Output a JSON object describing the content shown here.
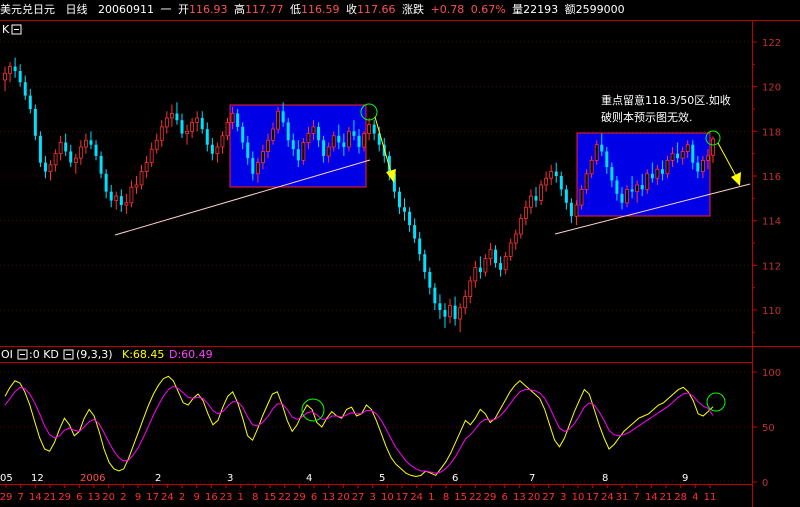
{
  "header": {
    "symbol": "美元兑日元",
    "period": "日线",
    "date": "20060911",
    "weekday": "一",
    "open_label": "开",
    "open": "116.93",
    "high_label": "高",
    "high": "117.77",
    "low_label": "低",
    "low": "116.59",
    "close_label": "收",
    "close": "117.66",
    "change_label": "涨跌",
    "change": "+0.78",
    "change_pct": "0.67%",
    "volume_label": "量",
    "volume": "22193",
    "amount_label": "额",
    "amount": "2599000"
  },
  "main_panel": {
    "label": "K",
    "annotation_line1": "重点留意118.3/50区.如收",
    "annotation_line2": "破则本预示图无效.",
    "colors": {
      "up": "#ff3232",
      "down": "#00e0ff",
      "box_fill": "#0000e6",
      "box_edge": "#ff2020",
      "trend": "#ffd0d0",
      "arrow": "#ffff00",
      "circle": "#00ff00",
      "axis": "#c00000"
    }
  },
  "indicator_panel": {
    "label": "OI",
    "sub_label": ":0 KD",
    "params": "(9,3,3)",
    "k_label": "K:68.45",
    "d_label": "D:60.49",
    "k_color": "#ffff00",
    "d_color": "#ff00ff"
  },
  "chart_data": [
    {
      "type": "candlestick",
      "y_axis_ticks": [
        "122",
        "120",
        "118",
        "116",
        "114",
        "112",
        "110"
      ],
      "ylim": [
        108.5,
        122.5
      ],
      "ohlc_approx": [
        [
          120.3,
          120.9,
          119.8,
          120.6
        ],
        [
          120.6,
          121.1,
          120.2,
          120.9
        ],
        [
          120.9,
          121.3,
          120.4,
          120.7
        ],
        [
          120.7,
          121.0,
          120.0,
          120.2
        ],
        [
          120.2,
          120.5,
          119.4,
          119.6
        ],
        [
          119.6,
          119.9,
          118.8,
          119.0
        ],
        [
          119.0,
          119.2,
          117.6,
          117.8
        ],
        [
          117.8,
          118.0,
          116.4,
          116.6
        ],
        [
          116.6,
          116.9,
          115.9,
          116.2
        ],
        [
          116.2,
          116.7,
          115.8,
          116.5
        ],
        [
          116.5,
          117.2,
          116.2,
          117.0
        ],
        [
          117.0,
          117.8,
          116.7,
          117.5
        ],
        [
          117.5,
          117.9,
          116.9,
          117.1
        ],
        [
          117.1,
          117.4,
          116.4,
          116.6
        ],
        [
          116.6,
          117.0,
          116.1,
          116.8
        ],
        [
          116.8,
          117.6,
          116.5,
          117.3
        ],
        [
          117.3,
          117.9,
          117.0,
          117.6
        ],
        [
          117.6,
          118.0,
          117.2,
          117.4
        ],
        [
          117.4,
          117.6,
          116.7,
          116.9
        ],
        [
          116.9,
          117.1,
          115.9,
          116.1
        ],
        [
          116.1,
          116.3,
          115.0,
          115.3
        ],
        [
          115.3,
          115.6,
          114.6,
          114.9
        ],
        [
          114.9,
          115.3,
          114.5,
          115.1
        ],
        [
          115.1,
          115.4,
          114.4,
          114.7
        ],
        [
          114.7,
          115.2,
          114.3,
          114.8
        ],
        [
          114.8,
          115.8,
          114.6,
          115.5
        ],
        [
          115.5,
          116.0,
          115.2,
          115.6
        ],
        [
          115.6,
          116.5,
          115.4,
          116.2
        ],
        [
          116.2,
          116.9,
          115.9,
          116.6
        ],
        [
          116.6,
          117.5,
          116.4,
          117.2
        ],
        [
          117.2,
          117.9,
          117.0,
          117.6
        ],
        [
          117.6,
          118.5,
          117.3,
          118.2
        ],
        [
          118.2,
          118.9,
          117.9,
          118.6
        ],
        [
          118.6,
          119.2,
          118.2,
          118.8
        ],
        [
          118.8,
          119.3,
          118.3,
          118.5
        ],
        [
          118.5,
          118.8,
          117.7,
          117.9
        ],
        [
          117.9,
          118.3,
          117.4,
          118.0
        ],
        [
          118.0,
          118.6,
          117.7,
          118.4
        ],
        [
          118.4,
          118.9,
          118.0,
          118.6
        ],
        [
          118.6,
          118.9,
          117.9,
          118.1
        ],
        [
          118.1,
          118.4,
          117.1,
          117.4
        ],
        [
          117.4,
          117.7,
          116.7,
          117.0
        ],
        [
          117.0,
          117.5,
          116.6,
          117.3
        ],
        [
          117.3,
          118.0,
          117.0,
          117.8
        ],
        [
          117.8,
          118.6,
          117.6,
          118.4
        ],
        [
          118.4,
          119.1,
          118.1,
          118.8
        ],
        [
          118.8,
          119.0,
          118.0,
          118.2
        ],
        [
          118.2,
          118.4,
          117.2,
          117.5
        ],
        [
          117.5,
          117.8,
          116.5,
          116.8
        ],
        [
          116.8,
          117.1,
          115.8,
          116.1
        ],
        [
          116.1,
          116.8,
          115.7,
          116.6
        ],
        [
          116.6,
          117.4,
          116.3,
          117.1
        ],
        [
          117.1,
          117.9,
          116.8,
          117.6
        ],
        [
          117.6,
          118.4,
          117.4,
          118.1
        ],
        [
          118.1,
          119.1,
          117.9,
          118.9
        ],
        [
          118.9,
          119.3,
          118.2,
          118.4
        ],
        [
          118.4,
          118.6,
          117.3,
          117.6
        ],
        [
          117.6,
          117.9,
          116.9,
          117.2
        ],
        [
          117.2,
          117.6,
          116.4,
          116.7
        ],
        [
          116.7,
          117.7,
          116.5,
          117.5
        ],
        [
          117.5,
          118.2,
          117.2,
          117.9
        ],
        [
          117.9,
          118.5,
          117.6,
          118.2
        ],
        [
          118.2,
          118.4,
          117.3,
          117.6
        ],
        [
          117.6,
          117.8,
          116.6,
          116.9
        ],
        [
          116.9,
          117.5,
          116.6,
          117.3
        ],
        [
          117.3,
          118.0,
          117.1,
          117.8
        ],
        [
          117.8,
          118.3,
          117.2,
          117.5
        ],
        [
          117.5,
          117.9,
          116.9,
          117.3
        ],
        [
          117.3,
          118.2,
          117.1,
          118.0
        ],
        [
          118.0,
          118.5,
          117.6,
          117.8
        ],
        [
          117.8,
          118.1,
          117.0,
          117.3
        ],
        [
          117.3,
          118.0,
          117.1,
          117.9
        ],
        [
          117.9,
          118.6,
          117.6,
          118.3
        ],
        [
          118.3,
          118.5,
          117.6,
          117.9
        ],
        [
          117.9,
          118.2,
          117.1,
          117.4
        ],
        [
          117.4,
          117.7,
          116.6,
          116.9
        ],
        [
          116.9,
          117.1,
          115.8,
          116.1
        ],
        [
          116.1,
          116.3,
          115.0,
          115.3
        ],
        [
          115.3,
          115.5,
          114.3,
          114.6
        ],
        [
          114.6,
          115.0,
          114.0,
          114.4
        ],
        [
          114.4,
          114.6,
          113.5,
          113.8
        ],
        [
          113.8,
          114.1,
          113.0,
          113.2
        ],
        [
          113.2,
          113.5,
          112.2,
          112.5
        ],
        [
          112.5,
          112.7,
          111.4,
          111.7
        ],
        [
          111.7,
          111.9,
          110.7,
          111.0
        ],
        [
          111.0,
          111.2,
          110.0,
          110.3
        ],
        [
          110.3,
          110.7,
          109.6,
          110.0
        ],
        [
          110.0,
          110.3,
          109.2,
          109.7
        ],
        [
          109.7,
          110.5,
          109.4,
          110.2
        ],
        [
          110.2,
          110.6,
          109.3,
          109.6
        ],
        [
          109.6,
          110.3,
          109.0,
          110.1
        ],
        [
          110.1,
          110.9,
          109.8,
          110.6
        ],
        [
          110.6,
          111.5,
          110.3,
          111.3
        ],
        [
          111.3,
          112.2,
          111.0,
          111.9
        ],
        [
          111.9,
          112.4,
          111.4,
          111.7
        ],
        [
          111.7,
          112.5,
          111.5,
          112.3
        ],
        [
          112.3,
          113.0,
          112.0,
          112.7
        ],
        [
          112.7,
          112.9,
          111.9,
          112.1
        ],
        [
          112.1,
          112.4,
          111.5,
          111.8
        ],
        [
          111.8,
          112.6,
          111.6,
          112.4
        ],
        [
          112.4,
          113.2,
          112.2,
          113.0
        ],
        [
          113.0,
          113.6,
          112.7,
          113.4
        ],
        [
          113.4,
          114.3,
          113.2,
          114.1
        ],
        [
          114.1,
          114.9,
          113.8,
          114.6
        ],
        [
          114.6,
          115.4,
          114.3,
          115.1
        ],
        [
          115.1,
          115.5,
          114.6,
          114.9
        ],
        [
          114.9,
          115.8,
          114.7,
          115.6
        ],
        [
          115.6,
          116.2,
          115.3,
          115.9
        ],
        [
          115.9,
          116.5,
          115.6,
          116.2
        ],
        [
          116.2,
          116.6,
          115.7,
          116.0
        ],
        [
          116.0,
          116.2,
          115.1,
          115.4
        ],
        [
          115.4,
          115.6,
          114.5,
          114.8
        ],
        [
          114.8,
          115.0,
          113.9,
          114.2
        ],
        [
          114.2,
          114.9,
          113.8,
          114.7
        ],
        [
          114.7,
          115.6,
          114.5,
          115.4
        ],
        [
          115.4,
          116.3,
          115.2,
          116.1
        ],
        [
          116.1,
          116.9,
          115.9,
          116.7
        ],
        [
          116.7,
          117.6,
          116.5,
          117.4
        ],
        [
          117.4,
          117.9,
          116.9,
          117.1
        ],
        [
          117.1,
          117.3,
          116.1,
          116.4
        ],
        [
          116.4,
          116.6,
          115.5,
          115.8
        ],
        [
          115.8,
          116.0,
          114.9,
          115.2
        ],
        [
          115.2,
          115.5,
          114.5,
          114.8
        ],
        [
          114.8,
          115.6,
          114.6,
          115.4
        ],
        [
          115.4,
          116.0,
          115.0,
          115.3
        ],
        [
          115.3,
          115.8,
          114.8,
          115.6
        ],
        [
          115.6,
          116.1,
          115.1,
          115.4
        ],
        [
          115.4,
          116.3,
          115.2,
          116.1
        ],
        [
          116.1,
          116.6,
          115.7,
          115.9
        ],
        [
          115.9,
          116.5,
          115.6,
          116.3
        ],
        [
          116.3,
          116.7,
          115.8,
          116.1
        ],
        [
          116.1,
          116.9,
          115.9,
          116.7
        ],
        [
          116.7,
          117.3,
          116.4,
          117.0
        ],
        [
          117.0,
          117.5,
          116.6,
          116.8
        ],
        [
          116.8,
          117.3,
          116.5,
          117.1
        ],
        [
          117.1,
          117.6,
          116.8,
          117.4
        ],
        [
          117.4,
          117.6,
          116.3,
          116.6
        ],
        [
          116.6,
          116.9,
          115.9,
          116.2
        ],
        [
          116.2,
          116.9,
          115.9,
          116.7
        ],
        [
          116.7,
          117.2,
          116.3,
          116.9
        ],
        [
          116.93,
          117.77,
          116.59,
          117.66
        ]
      ]
    },
    {
      "type": "line",
      "title": "KD(9,3,3)",
      "y_axis_ticks": [
        "100",
        "50",
        "0"
      ],
      "ylim": [
        0,
        100
      ],
      "series": [
        {
          "name": "K",
          "color": "#ffff00",
          "values": [
            78,
            86,
            92,
            90,
            82,
            70,
            55,
            40,
            30,
            28,
            36,
            48,
            58,
            52,
            42,
            46,
            58,
            66,
            60,
            46,
            30,
            18,
            12,
            10,
            12,
            22,
            34,
            46,
            58,
            70,
            80,
            88,
            94,
            96,
            92,
            82,
            72,
            70,
            76,
            80,
            74,
            62,
            52,
            56,
            68,
            78,
            82,
            72,
            58,
            42,
            38,
            48,
            60,
            70,
            80,
            82,
            70,
            56,
            46,
            52,
            62,
            70,
            66,
            54,
            50,
            58,
            64,
            60,
            58,
            66,
            68,
            60,
            62,
            70,
            66,
            56,
            44,
            32,
            22,
            16,
            12,
            8,
            6,
            5,
            6,
            10,
            8,
            6,
            12,
            18,
            26,
            36,
            46,
            56,
            52,
            58,
            66,
            62,
            54,
            58,
            66,
            74,
            82,
            88,
            92,
            88,
            84,
            80,
            76,
            66,
            52,
            38,
            32,
            40,
            52,
            64,
            74,
            84,
            80,
            66,
            52,
            40,
            30,
            34,
            40,
            46,
            50,
            54,
            58,
            60,
            62,
            66,
            70,
            72,
            76,
            80,
            84,
            86,
            82,
            74,
            62,
            60,
            64,
            68.45
          ]
        },
        {
          "name": "D",
          "color": "#ff00ff",
          "values": [
            70,
            76,
            82,
            86,
            85,
            80,
            72,
            62,
            51,
            43,
            40,
            42,
            47,
            49,
            47,
            46,
            50,
            55,
            57,
            53,
            45,
            36,
            28,
            22,
            19,
            20,
            25,
            32,
            41,
            51,
            61,
            70,
            78,
            84,
            87,
            85,
            81,
            77,
            76,
            77,
            76,
            71,
            65,
            62,
            64,
            69,
            73,
            73,
            68,
            59,
            52,
            51,
            54,
            59,
            66,
            71,
            71,
            66,
            59,
            57,
            59,
            63,
            64,
            61,
            57,
            57,
            60,
            60,
            59,
            61,
            63,
            62,
            62,
            65,
            65,
            62,
            56,
            48,
            39,
            31,
            25,
            19,
            15,
            12,
            10,
            10,
            9,
            8,
            9,
            12,
            17,
            23,
            31,
            39,
            43,
            48,
            54,
            57,
            56,
            57,
            60,
            65,
            71,
            77,
            82,
            84,
            84,
            83,
            81,
            76,
            68,
            58,
            49,
            46,
            48,
            53,
            60,
            68,
            72,
            70,
            64,
            56,
            47,
            43,
            42,
            43,
            45,
            48,
            51,
            54,
            57,
            60,
            63,
            66,
            69,
            73,
            77,
            80,
            81,
            78,
            73,
            69,
            67,
            60.49
          ]
        }
      ]
    }
  ],
  "x_axis": {
    "month_labels": [
      "05",
      "12",
      "2006",
      "2",
      "3",
      "4",
      "5",
      "6",
      "7",
      "8",
      "9"
    ],
    "day_labels": [
      "29",
      "7",
      "14",
      "21",
      "29",
      "6",
      "13",
      "20",
      "2",
      "9",
      "17",
      "24",
      "2",
      "9",
      "16",
      "23",
      "1",
      "8",
      "15",
      "22",
      "29",
      "6",
      "13",
      "20",
      "27",
      "3",
      "10",
      "17",
      "24",
      "1",
      "8",
      "15",
      "22",
      "29",
      "6",
      "13",
      "20",
      "27",
      "3",
      "10",
      "17",
      "24",
      "31",
      "7",
      "14",
      "21",
      "28",
      "4",
      "11"
    ]
  }
}
